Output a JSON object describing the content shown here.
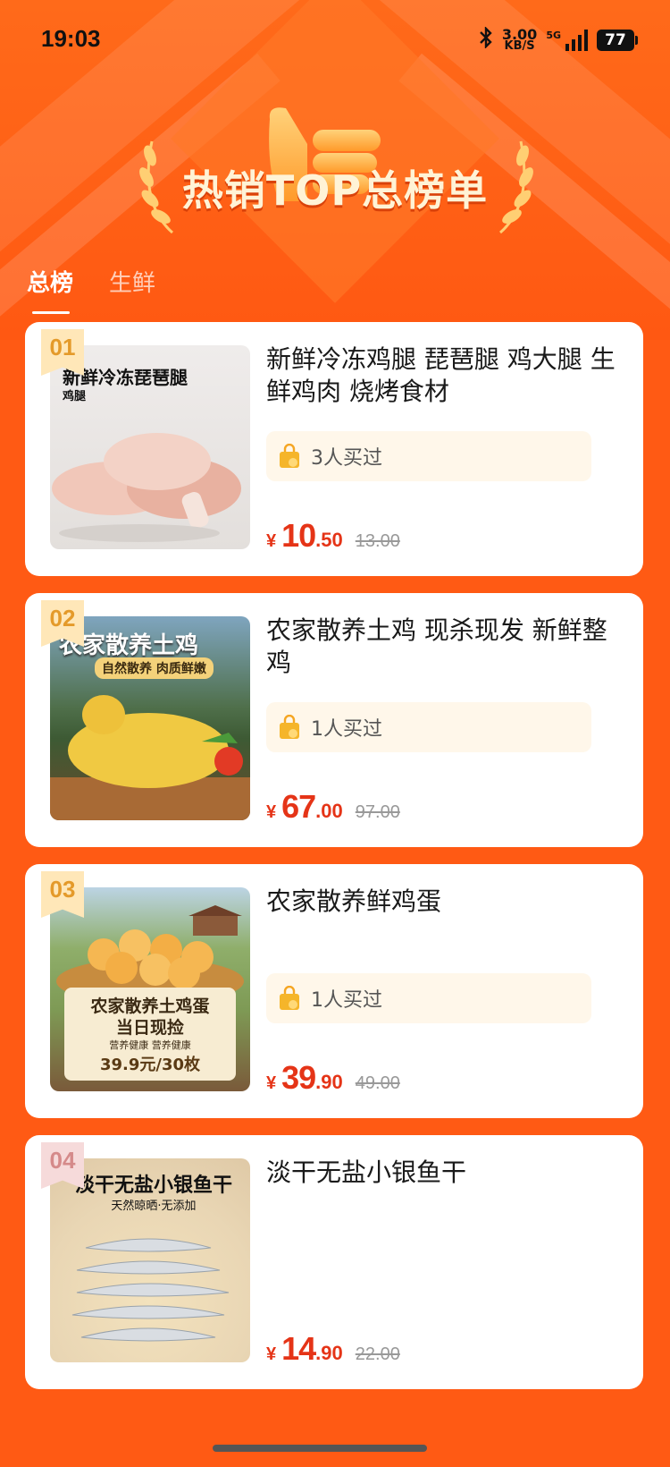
{
  "status_bar": {
    "time": "19:03",
    "net_speed_value": "3.00",
    "net_speed_unit": "KB/S",
    "network": "5G",
    "battery": "77"
  },
  "hero": {
    "title": "热销TOP总榜单"
  },
  "tabs": [
    {
      "label": "总榜",
      "active": true
    },
    {
      "label": "生鲜",
      "active": false
    }
  ],
  "products": [
    {
      "rank": "01",
      "title": "新鲜冷冻鸡腿 琵琶腿 鸡大腿 生鲜鸡肉 烧烤食材",
      "image_text": "新鲜冷冻琵琶腿",
      "image_sub": "鸡腿",
      "buyers": "3人买过",
      "currency": "¥",
      "price_int": "10",
      "price_dec": ".50",
      "original_price": "13.00"
    },
    {
      "rank": "02",
      "title": "农家散养土鸡 现杀现发 新鲜整鸡",
      "image_text": "农家散养土鸡",
      "image_sub": "自然散养 肉质鲜嫩",
      "buyers": "1人买过",
      "currency": "¥",
      "price_int": "67",
      "price_dec": ".00",
      "original_price": "97.00"
    },
    {
      "rank": "03",
      "title": "农家散养鲜鸡蛋",
      "image_text": "农家散养土鸡蛋",
      "image_text2": "当日现捡",
      "image_sub": "营养健康 营养健康",
      "image_price": "39.9元/30枚",
      "buyers": "1人买过",
      "currency": "¥",
      "price_int": "39",
      "price_dec": ".90",
      "original_price": "49.00"
    },
    {
      "rank": "04",
      "title": "淡干无盐小银鱼干",
      "image_text": "淡干无盐小银鱼干",
      "image_sub": "天然晾晒·无添加",
      "currency": "¥",
      "price_int": "14",
      "price_dec": ".90",
      "original_price": "22.00"
    }
  ]
}
